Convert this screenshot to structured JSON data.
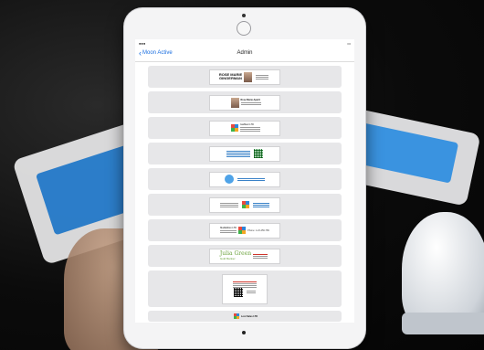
{
  "nav": {
    "back_label": "Moon Active",
    "title": "Admin"
  },
  "cards": {
    "card1_line1": "ROSE MARIE",
    "card1_line2": "GINGERMAN",
    "card2_name": "Rose Marie Apartt",
    "card3_name": "GarMant LTD",
    "card7_name": "ModEdition LTD",
    "card7_right": "Phone: 1-23-456-789",
    "card8_name": "Julia Green",
    "card8_sub": "Gold Banker",
    "card10_name": "Loot Sales LTD"
  },
  "colors": {
    "ios_blue": "#1a6ee0",
    "row_bg": "#e7e7e9",
    "green": "#6aa13a",
    "printer_blue": "#2e86d8"
  }
}
